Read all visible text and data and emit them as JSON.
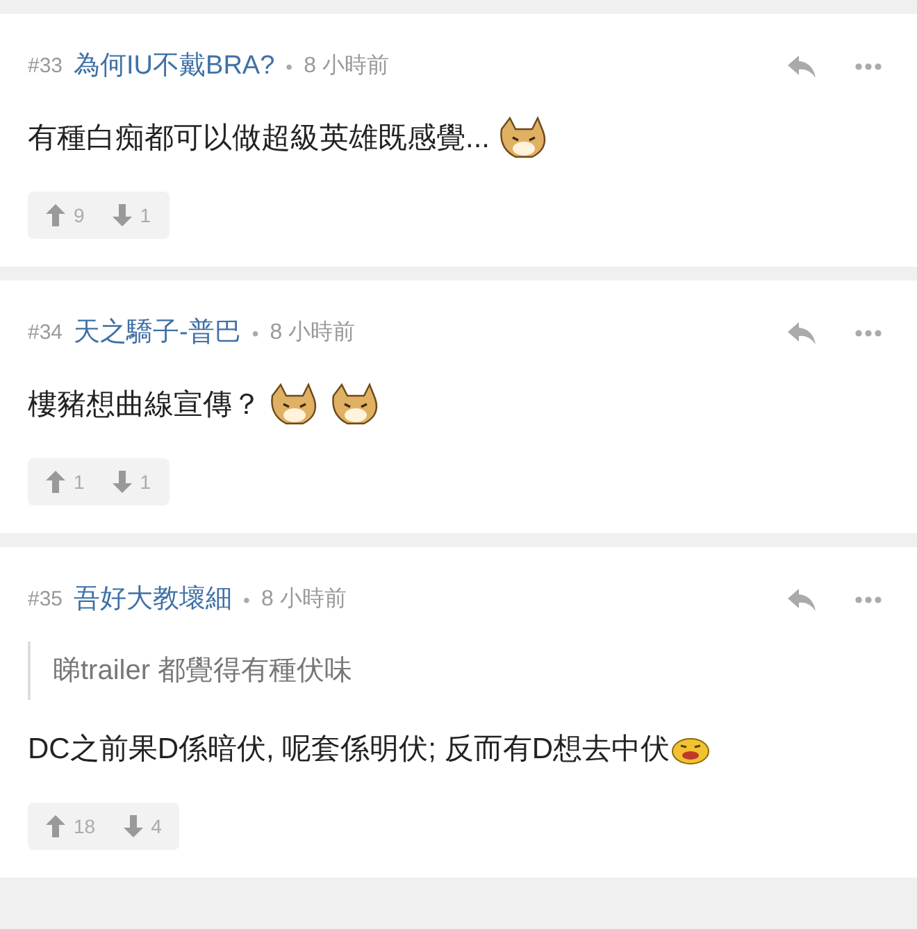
{
  "comments": [
    {
      "number": "#33",
      "username": "為何IU不戴BRA?",
      "separator": "•",
      "time": "8 小時前",
      "body": [
        {
          "kind": "text",
          "text": "有種白痴都可以做超級英雄既感覺..."
        },
        {
          "kind": "sticker"
        }
      ],
      "upvotes": "9",
      "downvotes": "1"
    },
    {
      "number": "#34",
      "username": "天之驕子-普巴",
      "separator": "•",
      "time": "8 小時前",
      "body": [
        {
          "kind": "text",
          "text": "樓豬想曲線宣傳？"
        },
        {
          "kind": "sticker"
        },
        {
          "kind": "sticker"
        }
      ],
      "upvotes": "1",
      "downvotes": "1"
    },
    {
      "number": "#35",
      "username": "吾好大教壞細",
      "separator": "•",
      "time": "8 小時前",
      "quote": "睇trailer 都覺得有種伏味",
      "body": [
        {
          "kind": "text",
          "text": "DC之前果D係暗伏, 呢套係明伏; 反而有D想去中伏"
        },
        {
          "kind": "small-sticker"
        }
      ],
      "upvotes": "18",
      "downvotes": "4"
    }
  ]
}
